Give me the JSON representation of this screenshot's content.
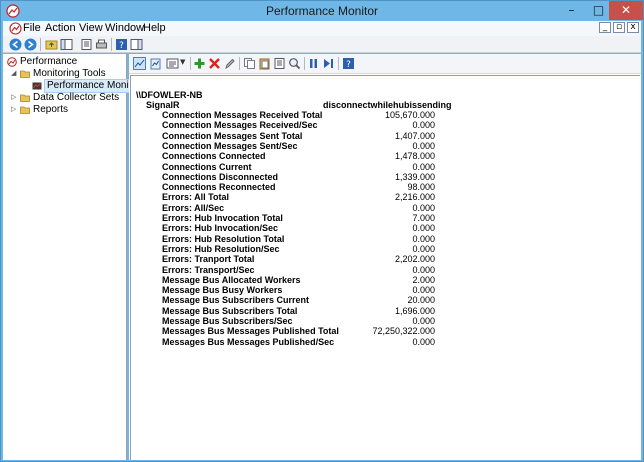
{
  "window": {
    "title": "Performance Monitor"
  },
  "controls": {
    "minimize": "–",
    "maximize": "□",
    "close": "✕"
  },
  "menu": {
    "items": [
      "File",
      "Action",
      "View",
      "Window",
      "Help"
    ]
  },
  "tree": {
    "items": [
      {
        "label": "Performance",
        "icon": "performance-icon"
      },
      {
        "label": "Monitoring Tools",
        "icon": "folder-icon"
      },
      {
        "label": "Performance Monitor",
        "icon": "chart-icon"
      },
      {
        "label": "Data Collector Sets",
        "icon": "folder-icon"
      },
      {
        "label": "Reports",
        "icon": "folder-icon"
      }
    ]
  },
  "report": {
    "machine": "\\\\DFOWLER-NB",
    "object": "SignalR",
    "instance": "disconnectwhilehubissending",
    "counters": [
      {
        "name": "Connection Messages Received Total",
        "value": "105,670.000"
      },
      {
        "name": "Connection Messages Received/Sec",
        "value": "0.000"
      },
      {
        "name": "Connection Messages Sent Total",
        "value": "1,407.000"
      },
      {
        "name": "Connection Messages Sent/Sec",
        "value": "0.000"
      },
      {
        "name": "Connections Connected",
        "value": "1,478.000"
      },
      {
        "name": "Connections Current",
        "value": "0.000"
      },
      {
        "name": "Connections Disconnected",
        "value": "1,339.000"
      },
      {
        "name": "Connections Reconnected",
        "value": "98.000"
      },
      {
        "name": "Errors: All Total",
        "value": "2,216.000"
      },
      {
        "name": "Errors: All/Sec",
        "value": "0.000"
      },
      {
        "name": "Errors: Hub Invocation Total",
        "value": "7.000"
      },
      {
        "name": "Errors: Hub Invocation/Sec",
        "value": "0.000"
      },
      {
        "name": "Errors: Hub Resolution Total",
        "value": "0.000"
      },
      {
        "name": "Errors: Hub Resolution/Sec",
        "value": "0.000"
      },
      {
        "name": "Errors: Tranport Total",
        "value": "2,202.000"
      },
      {
        "name": "Errors: Transport/Sec",
        "value": "0.000"
      },
      {
        "name": "Message Bus Allocated Workers",
        "value": "2.000"
      },
      {
        "name": "Message Bus Busy Workers",
        "value": "0.000"
      },
      {
        "name": "Message Bus Subscribers Current",
        "value": "20.000"
      },
      {
        "name": "Message Bus Subscribers Total",
        "value": "1,696.000"
      },
      {
        "name": "Message Bus Subscribers/Sec",
        "value": "0.000"
      },
      {
        "name": "Messages Bus Messages Published Total",
        "value": "72,250,322.000"
      },
      {
        "name": "Messages Bus Messages Published/Sec",
        "value": "0.000"
      }
    ]
  },
  "colors": {
    "titlebar": "#6eb7e6",
    "close": "#c7504b",
    "selection": "#dbeaf7"
  }
}
